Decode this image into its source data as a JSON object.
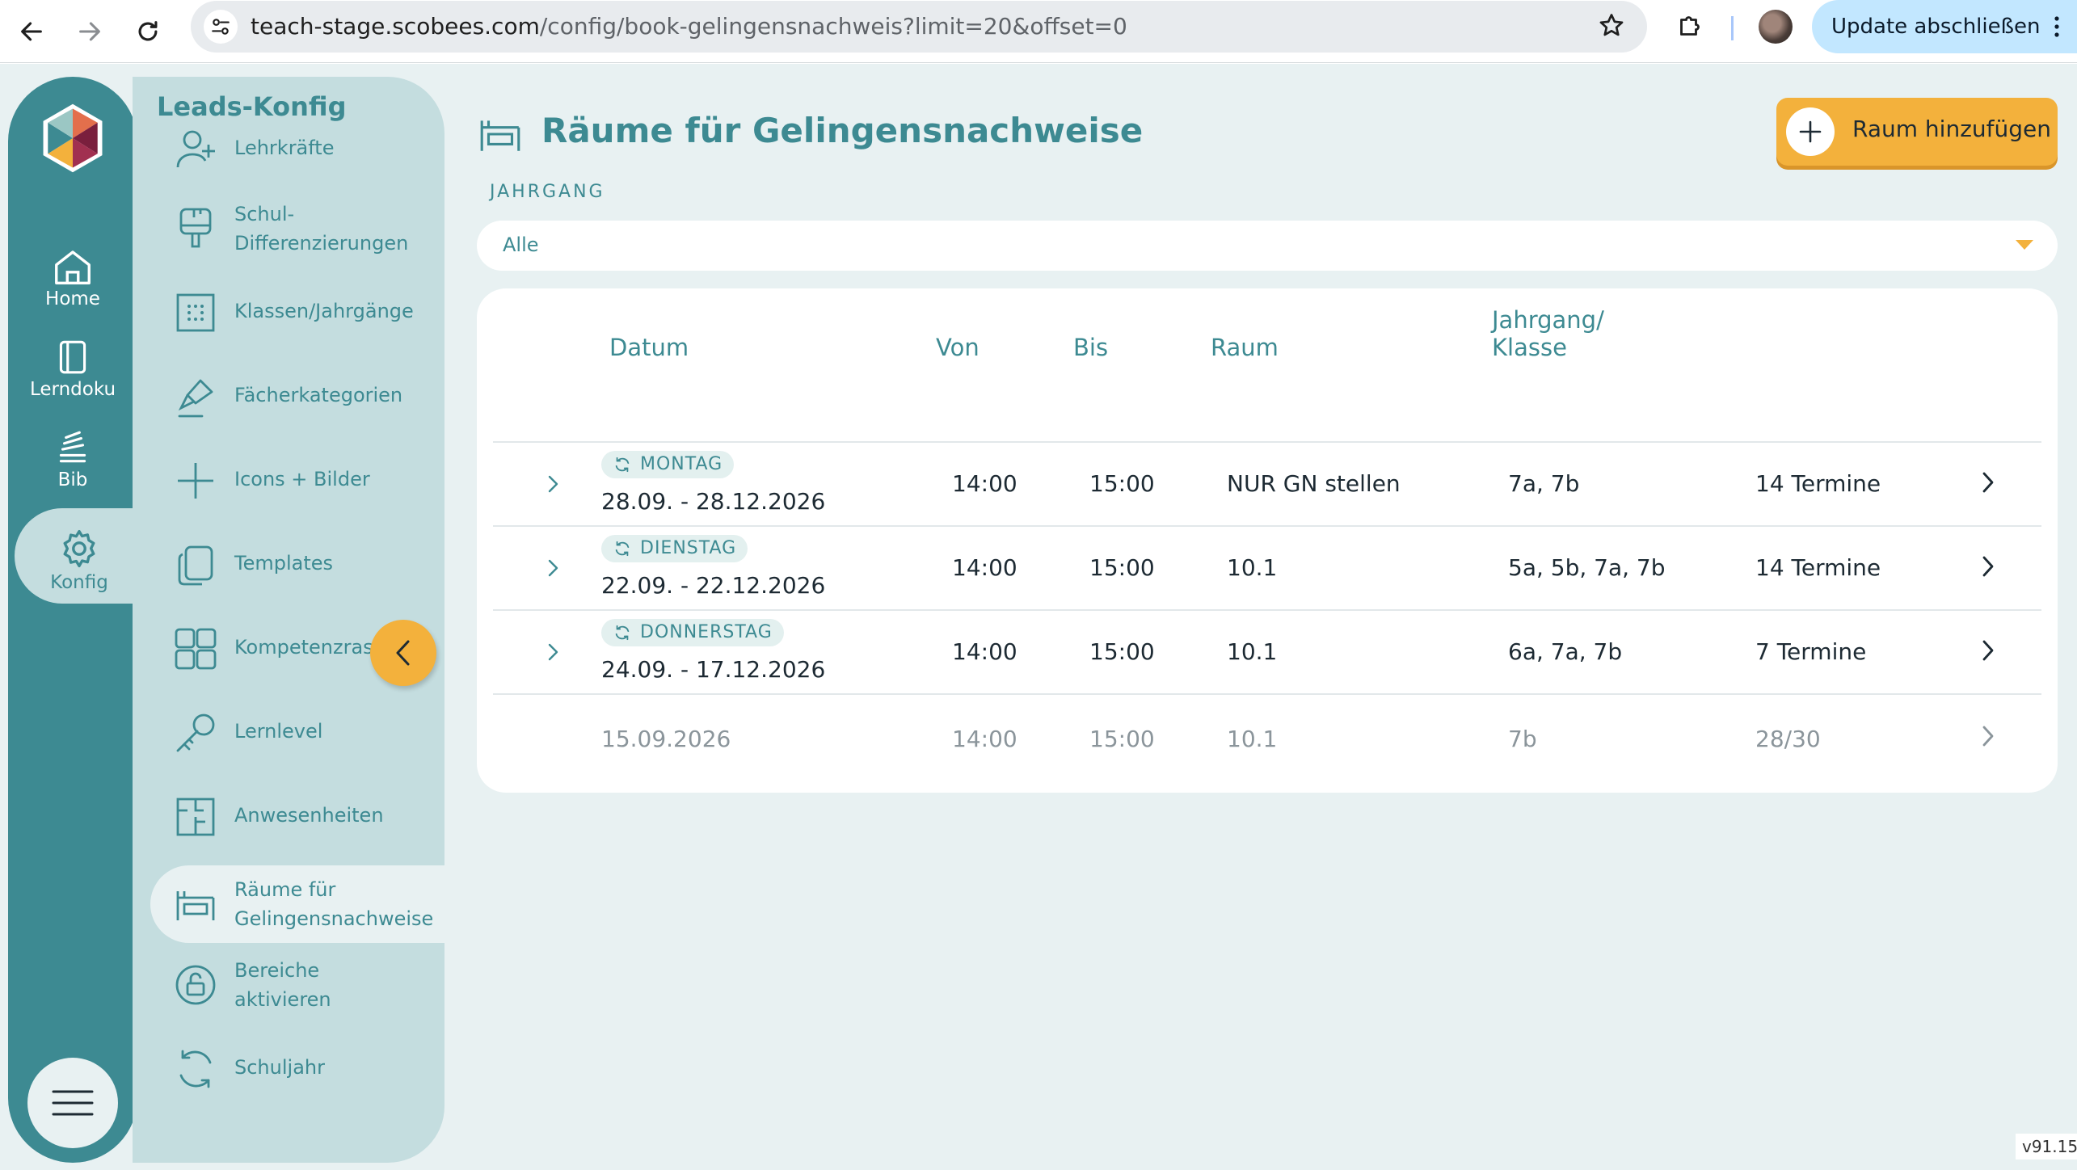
{
  "browser": {
    "url_host": "teach-stage.scobees.com",
    "url_path": "/config/book-gelingensnachweis?limit=20&offset=0",
    "update_label": "Update abschließen"
  },
  "rail": {
    "items": [
      {
        "label": "Home",
        "icon": "home-icon"
      },
      {
        "label": "Lerndoku",
        "icon": "notebook-icon"
      },
      {
        "label": "Bib",
        "icon": "books-icon"
      },
      {
        "label": "Konfig",
        "icon": "gear-icon",
        "active": true
      }
    ]
  },
  "subnav": {
    "title": "Leads-Konfig",
    "items": [
      {
        "label": "Lehrkräfte",
        "icon": "add-user-icon"
      },
      {
        "label": "Schul-\nDifferenzierungen",
        "icon": "brush-icon"
      },
      {
        "label": "Klassen/Jahrgänge",
        "icon": "grid-dots-icon"
      },
      {
        "label": "Fächerkategorien",
        "icon": "pen-icon"
      },
      {
        "label": "Icons + Bilder",
        "icon": "plus-icon"
      },
      {
        "label": "Templates",
        "icon": "copy-icon"
      },
      {
        "label": "Kompetenzraster",
        "icon": "grid-icon"
      },
      {
        "label": "Lernlevel",
        "icon": "key-icon"
      },
      {
        "label": "Anwesenheiten",
        "icon": "floorplan-icon"
      },
      {
        "label": "Räume für\nGelingensnachweise",
        "icon": "room-icon",
        "active": true
      },
      {
        "label": "Bereiche\naktivieren",
        "icon": "unlock-icon"
      },
      {
        "label": "Schuljahr",
        "icon": "refresh-icon"
      }
    ]
  },
  "main": {
    "title": "Räume für Gelingensnachweise",
    "add_button": "Raum hinzufügen",
    "filter": {
      "label": "JAHRGANG",
      "value": "Alle"
    },
    "columns": [
      "Datum",
      "Von",
      "Bis",
      "Raum",
      "Jahrgang/\nKlasse"
    ],
    "rows": [
      {
        "weekday": "MONTAG",
        "date": "28.09. - 28.12.2026",
        "from": "14:00",
        "to": "15:00",
        "room": "NUR GN stellen",
        "classes": "7a, 7b",
        "count": "14 Termine",
        "recurring": true
      },
      {
        "weekday": "DIENSTAG",
        "date": "22.09. - 22.12.2026",
        "from": "14:00",
        "to": "15:00",
        "room": "10.1",
        "classes": "5a, 5b, 7a, 7b",
        "count": "14 Termine",
        "recurring": true
      },
      {
        "weekday": "DONNERSTAG",
        "date": "24.09. - 17.12.2026",
        "from": "14:00",
        "to": "15:00",
        "room": "10.1",
        "classes": "6a, 7a, 7b",
        "count": "7 Termine",
        "recurring": true
      },
      {
        "weekday": "",
        "date": "15.09.2026",
        "from": "14:00",
        "to": "15:00",
        "room": "10.1",
        "classes": "7b",
        "count": "28/30",
        "recurring": false
      }
    ]
  },
  "version": "v91.15",
  "colors": {
    "primary": "#3d8a92",
    "accent": "#f3b13c",
    "panel": "#c4dddf",
    "background": "#e8f1f2"
  }
}
